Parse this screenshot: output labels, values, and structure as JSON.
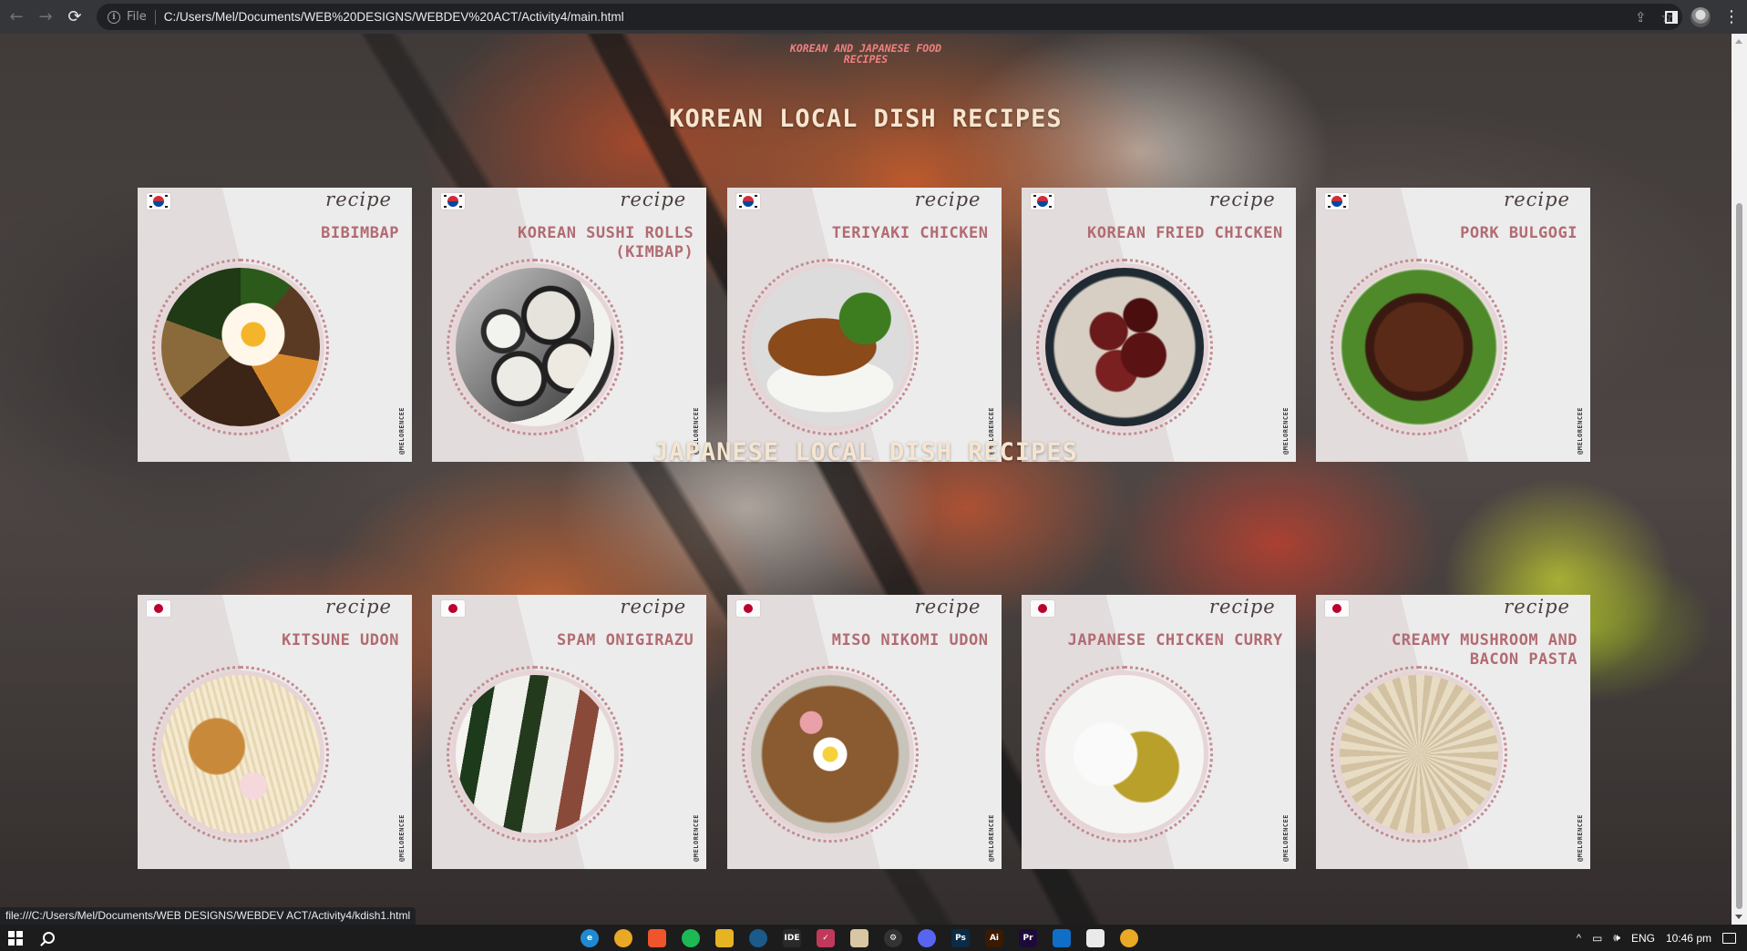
{
  "browser": {
    "file_label": "File",
    "url": "C:/Users/Mel/Documents/WEB%20DESIGNS/WEBDEV%20ACT/Activity4/main.html",
    "status_url": "file:///C:/Users/Mel/Documents/WEB DESIGNS/WEBDEV ACT/Activity4/kdish1.html"
  },
  "page": {
    "brand": "KOREAN AND JAPANESE FOOD RECIPES",
    "recipe_script": "recipe",
    "handle": "@MELORENCEE",
    "korean_section": {
      "title": "KOREAN LOCAL DISH RECIPES",
      "flag": "korea-flag-icon",
      "dishes": [
        {
          "name": "BIBIMBAP",
          "food": "bibimbap"
        },
        {
          "name": "KOREAN SUSHI ROLLS (KIMBAP)",
          "food": "kimbap"
        },
        {
          "name": "TERIYAKI CHICKEN",
          "food": "teriyaki"
        },
        {
          "name": "KOREAN FRIED CHICKEN",
          "food": "friedchicken"
        },
        {
          "name": "PORK BULGOGI",
          "food": "bulgogi"
        }
      ]
    },
    "japanese_section": {
      "title": "JAPANESE LOCAL DISH RECIPES",
      "flag": "japan-flag-icon",
      "dishes": [
        {
          "name": "KITSUNE UDON",
          "food": "kitsune"
        },
        {
          "name": "SPAM ONIGIRAZU",
          "food": "onigiri"
        },
        {
          "name": "MISO NIKOMI UDON",
          "food": "miso"
        },
        {
          "name": "JAPANESE CHICKEN CURRY",
          "food": "curry"
        },
        {
          "name": "CREAMY MUSHROOM AND BACON PASTA",
          "food": "pasta"
        }
      ]
    }
  },
  "taskbar": {
    "apps": [
      {
        "name": "edge-icon",
        "glyph": "e",
        "color": "#1f8ad2",
        "round": true
      },
      {
        "name": "chrome-icon",
        "glyph": "",
        "color": "#e9a825",
        "round": true
      },
      {
        "name": "brave-icon",
        "glyph": "",
        "color": "#f0542d",
        "round": false
      },
      {
        "name": "spotify-icon",
        "glyph": "",
        "color": "#1db954",
        "round": true
      },
      {
        "name": "file-explorer-icon",
        "glyph": "",
        "color": "#e6b422",
        "round": false
      },
      {
        "name": "steam-icon",
        "glyph": "",
        "color": "#1b5a8a",
        "round": true
      },
      {
        "name": "ide-icon",
        "glyph": "IDE",
        "color": "#2a2a2a",
        "round": false
      },
      {
        "name": "todo-icon",
        "glyph": "✓",
        "color": "#c0395a",
        "round": false
      },
      {
        "name": "paint-icon",
        "glyph": "",
        "color": "#d8c7a2",
        "round": false
      },
      {
        "name": "settings-icon",
        "glyph": "⚙",
        "color": "#333",
        "round": true
      },
      {
        "name": "discord-icon",
        "glyph": "",
        "color": "#5865f2",
        "round": true
      },
      {
        "name": "photoshop-icon",
        "glyph": "Ps",
        "color": "#0c2b46",
        "round": false
      },
      {
        "name": "illustrator-icon",
        "glyph": "Ai",
        "color": "#3a1a00",
        "round": false
      },
      {
        "name": "premiere-icon",
        "glyph": "Pr",
        "color": "#1e0a3a",
        "round": false
      },
      {
        "name": "vscode-icon",
        "glyph": "",
        "color": "#0f6fc6",
        "round": false
      },
      {
        "name": "github-icon",
        "glyph": "",
        "color": "#eaeaea",
        "round": false
      },
      {
        "name": "chrome-active-icon",
        "glyph": "",
        "color": "#e9a825",
        "round": true
      }
    ],
    "language": "ENG",
    "time": "10:46 pm"
  }
}
